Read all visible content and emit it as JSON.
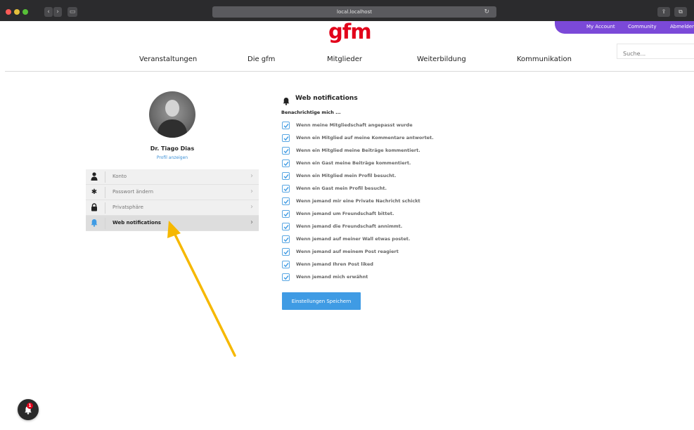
{
  "browser": {
    "url": "local.localhost",
    "back_icon": "chevron-left-icon",
    "forward_icon": "chevron-right-icon",
    "sidebar_icon": "sidebar-icon",
    "reload_icon": "reload-icon",
    "share_icon": "share-icon",
    "tabs_icon": "tabs-icon"
  },
  "topbar": {
    "account": "My Account",
    "community": "Community",
    "logout": "Abmelden",
    "color": "#7b49d8"
  },
  "header": {
    "logo": "gfm",
    "logo_color": "#e2001a",
    "search_placeholder": "Suche...",
    "nav": [
      "Veranstaltungen",
      "Die gfm",
      "Mitglieder",
      "Weiterbildung",
      "Kommunikation"
    ]
  },
  "profile": {
    "name": "Dr. Tiago Dias",
    "link": "Profil anzeigen"
  },
  "menu": [
    {
      "label": "Konto",
      "icon": "user-icon",
      "active": false
    },
    {
      "label": "Passwort ändern",
      "icon": "asterisk-icon",
      "active": false
    },
    {
      "label": "Privatsphäre",
      "icon": "lock-icon",
      "active": false
    },
    {
      "label": "Web notifications",
      "icon": "bell-icon",
      "active": true
    }
  ],
  "notifications": {
    "title": "Web notifications",
    "subtitle": "Benachrichtige mich ...",
    "accent": "#3f9be4",
    "items": [
      "Wenn meine Mitgliedschaft angepasst wurde",
      "Wenn ein Mitglied auf meine Kommentare antwortet.",
      "Wenn ein Mitglied meine Beiträge kommentiert.",
      "Wenn ein Gast meine Beiträge kommentiert.",
      "Wenn ein Mitglied mein Profil besucht.",
      "Wenn ein Gast mein Profil besucht.",
      "Wenn jemand mir eine Private Nachricht schickt",
      "Wenn jemand um Freundschaft bittet.",
      "Wenn jemand die Freundschaft annimmt.",
      "Wenn jemand auf meiner Wall etwas postet.",
      "Wenn jemand auf meinem Post reagiert",
      "Wenn jemand Ihren Post liked",
      "Wenn jemand mich erwähnt"
    ],
    "save_label": "Einstellungen Speichern"
  },
  "floating": {
    "badge": "1"
  },
  "annotation": {
    "arrow_color": "#f6b800"
  }
}
